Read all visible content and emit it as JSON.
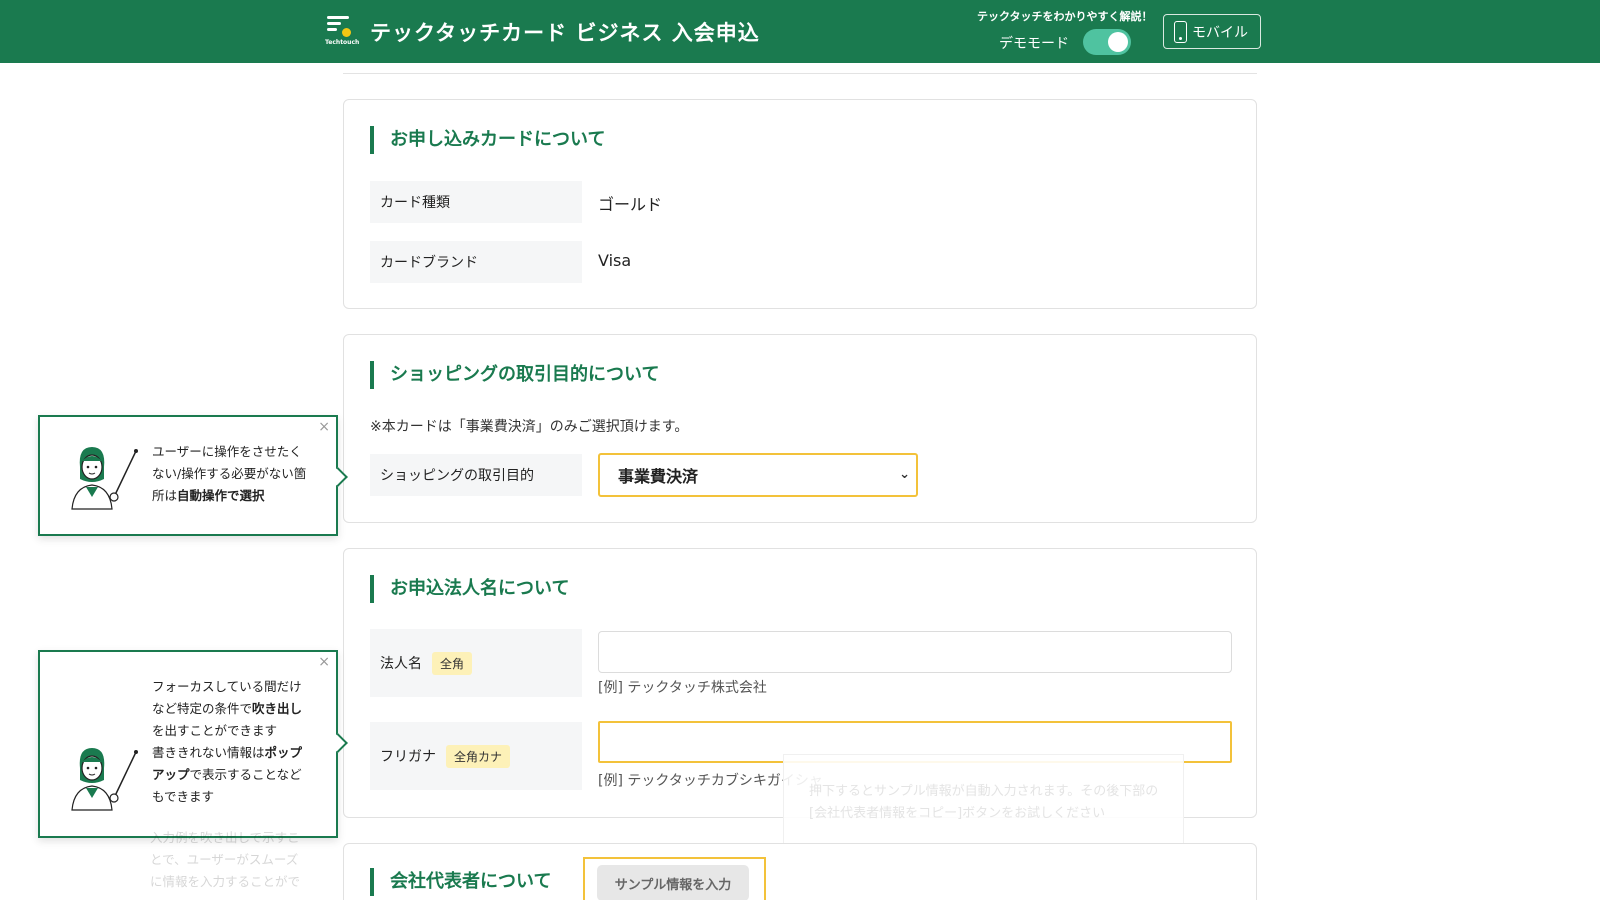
{
  "header": {
    "logo_text": "Techtouch",
    "title": "テックタッチカード ビジネス 入会申込",
    "demo_caption": "テックタッチをわかりやすく解説！",
    "demo_label": "デモモード",
    "mobile_label": "モバイル"
  },
  "card_section": {
    "title": "お申し込みカードについて",
    "card_type_label": "カード種類",
    "card_type_value": "ゴールド",
    "card_brand_label": "カードブランド",
    "card_brand_value": "Visa"
  },
  "shopping_section": {
    "title": "ショッピングの取引目的について",
    "note": "※本カードは「事業費決済」のみご選択頂けます。",
    "purpose_label": "ショッピングの取引目的",
    "purpose_value": "事業費決済"
  },
  "corp_section": {
    "title": "お申込法人名について",
    "name_label": "法人名",
    "name_badge": "全角",
    "name_example": "[例] テックタッチ株式会社",
    "kana_label": "フリガナ",
    "kana_badge": "全角カナ",
    "kana_example": "[例] テックタッチカブシキガイシャ",
    "ghost_tip_line1": "押下するとサンプル情報が自動入力されます。その後下部の",
    "ghost_tip_line2": "[会社代表者情報をコピー]ボタンをお試しください"
  },
  "rep_section": {
    "title": "会社代表者について",
    "sample_button": "サンプル情報を入力"
  },
  "callouts": {
    "first": {
      "line1": "ユーザーに操作をさせたく",
      "line2": "ない/操作する必要がない箇",
      "line3_plain": "所は",
      "line3_bold": "自動操作で選択"
    },
    "second": {
      "line1": "フォーカスしている間だけ",
      "line2_plain": "など特定の条件で",
      "line2_bold": "吹き出し",
      "line3": "を出すことができます",
      "line4_plain": "書ききれない情報は",
      "line4_bold": "ポップ",
      "line5_bold": "アップ",
      "line5_plain": "で表示することなど",
      "line6": "もできます"
    },
    "third": {
      "line1": "入力例を吹き出しで示すこ",
      "line2": "とで、ユーザーがスムーズ",
      "line3": "に情報を入力することがで"
    },
    "close_glyph": "×"
  },
  "colors": {
    "brand_green": "#1a7a4f",
    "highlight_yellow": "#f3c23a",
    "toggle_on": "#4fc3a0"
  }
}
